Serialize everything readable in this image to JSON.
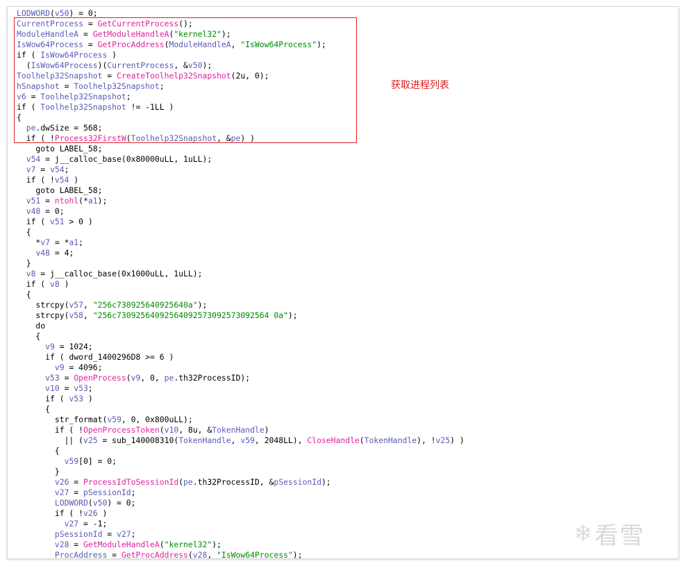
{
  "annotation": {
    "text": "获取进程列表"
  },
  "watermark": {
    "icon": "snowflake-icon",
    "text": "看雪"
  },
  "colors": {
    "variable": "#595bb5",
    "function": "#e0209f",
    "string": "#008a00",
    "highlight": "#e02020"
  },
  "code_lines": [
    [
      [
        "v",
        "LODWORD"
      ],
      [
        "t",
        "("
      ],
      [
        "v",
        "v50"
      ],
      [
        "t",
        ") = 0;"
      ]
    ],
    [
      [
        "v",
        "CurrentProcess"
      ],
      [
        "t",
        " = "
      ],
      [
        "f",
        "GetCurrentProcess"
      ],
      [
        "t",
        "();"
      ]
    ],
    [
      [
        "v",
        "ModuleHandleA"
      ],
      [
        "t",
        " = "
      ],
      [
        "f",
        "GetModuleHandleA"
      ],
      [
        "t",
        "("
      ],
      [
        "s",
        "\"kernel32\""
      ],
      [
        "t",
        ");"
      ]
    ],
    [
      [
        "v",
        "IsWow64Process"
      ],
      [
        "t",
        " = "
      ],
      [
        "f",
        "GetProcAddress"
      ],
      [
        "t",
        "("
      ],
      [
        "v",
        "ModuleHandleA"
      ],
      [
        "t",
        ", "
      ],
      [
        "s",
        "\"IsWow64Process\""
      ],
      [
        "t",
        ");"
      ]
    ],
    [
      [
        "t",
        "if ( "
      ],
      [
        "v",
        "IsWow64Process"
      ],
      [
        "t",
        " )"
      ]
    ],
    [
      [
        "t",
        "  ("
      ],
      [
        "v",
        "IsWow64Process"
      ],
      [
        "t",
        ")("
      ],
      [
        "v",
        "CurrentProcess"
      ],
      [
        "t",
        ", &"
      ],
      [
        "v",
        "v50"
      ],
      [
        "t",
        ");"
      ]
    ],
    [
      [
        "v",
        "Toolhelp32Snapshot"
      ],
      [
        "t",
        " = "
      ],
      [
        "f",
        "CreateToolhelp32Snapshot"
      ],
      [
        "t",
        "(2u, 0);"
      ]
    ],
    [
      [
        "v",
        "hSnapshot"
      ],
      [
        "t",
        " = "
      ],
      [
        "v",
        "Toolhelp32Snapshot"
      ],
      [
        "t",
        ";"
      ]
    ],
    [
      [
        "v",
        "v6"
      ],
      [
        "t",
        " = "
      ],
      [
        "v",
        "Toolhelp32Snapshot"
      ],
      [
        "t",
        ";"
      ]
    ],
    [
      [
        "t",
        "if ( "
      ],
      [
        "v",
        "Toolhelp32Snapshot"
      ],
      [
        "t",
        " != -1LL )"
      ]
    ],
    [
      [
        "t",
        "{"
      ]
    ],
    [
      [
        "t",
        "  "
      ],
      [
        "v",
        "pe"
      ],
      [
        "t",
        ".dwSize = 568;"
      ]
    ],
    [
      [
        "t",
        "  if ( !"
      ],
      [
        "f",
        "Process32FirstW"
      ],
      [
        "t",
        "("
      ],
      [
        "v",
        "Toolhelp32Snapshot"
      ],
      [
        "t",
        ", &"
      ],
      [
        "v",
        "pe"
      ],
      [
        "t",
        ") )"
      ]
    ],
    [
      [
        "t",
        "    goto LABEL_58;"
      ]
    ],
    [
      [
        "t",
        "  "
      ],
      [
        "v",
        "v54"
      ],
      [
        "t",
        " = j__calloc_base(0x80000uLL, 1uLL);"
      ]
    ],
    [
      [
        "t",
        "  "
      ],
      [
        "v",
        "v7"
      ],
      [
        "t",
        " = "
      ],
      [
        "v",
        "v54"
      ],
      [
        "t",
        ";"
      ]
    ],
    [
      [
        "t",
        "  if ( !"
      ],
      [
        "v",
        "v54"
      ],
      [
        "t",
        " )"
      ]
    ],
    [
      [
        "t",
        "    goto LABEL_58;"
      ]
    ],
    [
      [
        "t",
        "  "
      ],
      [
        "v",
        "v51"
      ],
      [
        "t",
        " = "
      ],
      [
        "f",
        "ntohl"
      ],
      [
        "t",
        "(*"
      ],
      [
        "v",
        "a1"
      ],
      [
        "t",
        ");"
      ]
    ],
    [
      [
        "t",
        "  "
      ],
      [
        "v",
        "v48"
      ],
      [
        "t",
        " = 0;"
      ]
    ],
    [
      [
        "t",
        "  if ( "
      ],
      [
        "v",
        "v51"
      ],
      [
        "t",
        " > 0 )"
      ]
    ],
    [
      [
        "t",
        "  {"
      ]
    ],
    [
      [
        "t",
        "    *"
      ],
      [
        "v",
        "v7"
      ],
      [
        "t",
        " = *"
      ],
      [
        "v",
        "a1"
      ],
      [
        "t",
        ";"
      ]
    ],
    [
      [
        "t",
        "    "
      ],
      [
        "v",
        "v48"
      ],
      [
        "t",
        " = 4;"
      ]
    ],
    [
      [
        "t",
        "  }"
      ]
    ],
    [
      [
        "t",
        "  "
      ],
      [
        "v",
        "v8"
      ],
      [
        "t",
        " = j__calloc_base(0x1000uLL, 1uLL);"
      ]
    ],
    [
      [
        "t",
        "  if ( "
      ],
      [
        "v",
        "v8"
      ],
      [
        "t",
        " )"
      ]
    ],
    [
      [
        "t",
        "  {"
      ]
    ],
    [
      [
        "t",
        "    strcpy("
      ],
      [
        "v",
        "v57"
      ],
      [
        "t",
        ", "
      ],
      [
        "s",
        "\"256c730925640925640a\""
      ],
      [
        "t",
        ");"
      ]
    ],
    [
      [
        "t",
        "    strcpy("
      ],
      [
        "v",
        "v58"
      ],
      [
        "t",
        ", "
      ],
      [
        "s",
        "\"256c73092564092564092573092573092564 0a\""
      ],
      [
        "t",
        ");"
      ]
    ],
    [
      [
        "t",
        "    do"
      ]
    ],
    [
      [
        "t",
        "    {"
      ]
    ],
    [
      [
        "t",
        "      "
      ],
      [
        "v",
        "v9"
      ],
      [
        "t",
        " = 1024;"
      ]
    ],
    [
      [
        "t",
        "      if ( dword_1400296D8 >= 6 )"
      ]
    ],
    [
      [
        "t",
        "        "
      ],
      [
        "v",
        "v9"
      ],
      [
        "t",
        " = 4096;"
      ]
    ],
    [
      [
        "t",
        "      "
      ],
      [
        "v",
        "v53"
      ],
      [
        "t",
        " = "
      ],
      [
        "f",
        "OpenProcess"
      ],
      [
        "t",
        "("
      ],
      [
        "v",
        "v9"
      ],
      [
        "t",
        ", 0, "
      ],
      [
        "v",
        "pe"
      ],
      [
        "t",
        ".th32ProcessID);"
      ]
    ],
    [
      [
        "t",
        "      "
      ],
      [
        "v",
        "v10"
      ],
      [
        "t",
        " = "
      ],
      [
        "v",
        "v53"
      ],
      [
        "t",
        ";"
      ]
    ],
    [
      [
        "t",
        "      if ( "
      ],
      [
        "v",
        "v53"
      ],
      [
        "t",
        " )"
      ]
    ],
    [
      [
        "t",
        "      {"
      ]
    ],
    [
      [
        "t",
        "        str_format("
      ],
      [
        "v",
        "v59"
      ],
      [
        "t",
        ", 0, 0x800uLL);"
      ]
    ],
    [
      [
        "t",
        "        if ( !"
      ],
      [
        "f",
        "OpenProcessToken"
      ],
      [
        "t",
        "("
      ],
      [
        "v",
        "v10"
      ],
      [
        "t",
        ", 8u, &"
      ],
      [
        "v",
        "TokenHandle"
      ],
      [
        "t",
        ")"
      ]
    ],
    [
      [
        "t",
        "          || ("
      ],
      [
        "v",
        "v25"
      ],
      [
        "t",
        " = sub_140008310("
      ],
      [
        "v",
        "TokenHandle"
      ],
      [
        "t",
        ", "
      ],
      [
        "v",
        "v59"
      ],
      [
        "t",
        ", 2048LL), "
      ],
      [
        "f",
        "CloseHandle"
      ],
      [
        "t",
        "("
      ],
      [
        "v",
        "TokenHandle"
      ],
      [
        "t",
        "), !"
      ],
      [
        "v",
        "v25"
      ],
      [
        "t",
        ") )"
      ]
    ],
    [
      [
        "t",
        "        {"
      ]
    ],
    [
      [
        "t",
        "          "
      ],
      [
        "v",
        "v59"
      ],
      [
        "t",
        "[0] = 0;"
      ]
    ],
    [
      [
        "t",
        "        }"
      ]
    ],
    [
      [
        "t",
        "        "
      ],
      [
        "v",
        "v26"
      ],
      [
        "t",
        " = "
      ],
      [
        "f",
        "ProcessIdToSessionId"
      ],
      [
        "t",
        "("
      ],
      [
        "v",
        "pe"
      ],
      [
        "t",
        ".th32ProcessID, &"
      ],
      [
        "v",
        "pSessionId"
      ],
      [
        "t",
        ");"
      ]
    ],
    [
      [
        "t",
        "        "
      ],
      [
        "v",
        "v27"
      ],
      [
        "t",
        " = "
      ],
      [
        "v",
        "pSessionId"
      ],
      [
        "t",
        ";"
      ]
    ],
    [
      [
        "t",
        "        "
      ],
      [
        "v",
        "LODWORD"
      ],
      [
        "t",
        "("
      ],
      [
        "v",
        "v50"
      ],
      [
        "t",
        ") = 0;"
      ]
    ],
    [
      [
        "t",
        "        if ( !"
      ],
      [
        "v",
        "v26"
      ],
      [
        "t",
        " )"
      ]
    ],
    [
      [
        "t",
        "          "
      ],
      [
        "v",
        "v27"
      ],
      [
        "t",
        " = -1;"
      ]
    ],
    [
      [
        "t",
        "        "
      ],
      [
        "v",
        "pSessionId"
      ],
      [
        "t",
        " = "
      ],
      [
        "v",
        "v27"
      ],
      [
        "t",
        ";"
      ]
    ],
    [
      [
        "t",
        "        "
      ],
      [
        "v",
        "v28"
      ],
      [
        "t",
        " = "
      ],
      [
        "f",
        "GetModuleHandleA"
      ],
      [
        "t",
        "("
      ],
      [
        "s",
        "\"kernel32\""
      ],
      [
        "t",
        ");"
      ]
    ],
    [
      [
        "t",
        "        "
      ],
      [
        "v",
        "ProcAddress"
      ],
      [
        "t",
        " = "
      ],
      [
        "f",
        "GetProcAddress"
      ],
      [
        "t",
        "("
      ],
      [
        "v",
        "v28"
      ],
      [
        "t",
        ", "
      ],
      [
        "s",
        "\"IsWow64Process\""
      ],
      [
        "t",
        ");"
      ]
    ]
  ]
}
